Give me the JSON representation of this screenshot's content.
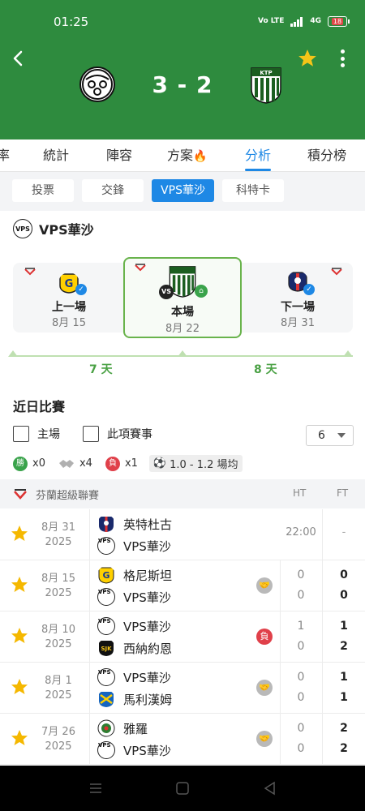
{
  "status": {
    "time": "01:25",
    "network": "4G",
    "volte": "Vo LTE",
    "battery": "18"
  },
  "header": {
    "score": "3 - 2",
    "home_team_icon": "vps-crest-icon",
    "away_team_icon": "ktp-crest-icon",
    "favorite_color": "#f5c518"
  },
  "tabs": [
    {
      "label": "率"
    },
    {
      "label": "統計"
    },
    {
      "label": "陣容"
    },
    {
      "label": "方案"
    },
    {
      "label": "分析",
      "active": true
    },
    {
      "label": "積分榜"
    }
  ],
  "subtabs": [
    {
      "label": "投票"
    },
    {
      "label": "交鋒"
    },
    {
      "label": "VPS華沙",
      "active": true
    },
    {
      "label": "科特卡"
    }
  ],
  "team_section": {
    "title": "VPS華沙"
  },
  "timeline": {
    "prev": {
      "label": "上一場",
      "date": "8月 15"
    },
    "current": {
      "label": "本場",
      "date": "8月 22"
    },
    "next": {
      "label": "下一場",
      "date": "8月 31"
    },
    "gap_before": "7 天",
    "gap_after": "8 天"
  },
  "recent": {
    "title": "近日比賽",
    "filter_home": "主場",
    "filter_competition": "此項賽事",
    "count": "6",
    "wins": "x0",
    "draws": "x4",
    "losses": "x1",
    "win_badge": "勝",
    "loss_badge": "負",
    "avg": "1.0 - 1.2 場均"
  },
  "league": {
    "name": "芬蘭超級聯賽",
    "ht": "HT",
    "ft": "FT"
  },
  "matches": [
    {
      "date": "8月 31",
      "year": "2025",
      "home": "英特杜古",
      "away": "VPS華沙",
      "kickoff": "22:00",
      "ft_placeholder": "-"
    },
    {
      "date": "8月 15",
      "year": "2025",
      "home": "格尼斯坦",
      "away": "VPS華沙",
      "ht_home": "0",
      "ht_away": "0",
      "ft_home": "0",
      "ft_away": "0",
      "result": "draw"
    },
    {
      "date": "8月 10",
      "year": "2025",
      "home": "VPS華沙",
      "away": "西納約恩",
      "ht_home": "1",
      "ht_away": "0",
      "ft_home": "1",
      "ft_away": "2",
      "result": "loss",
      "result_label": "負"
    },
    {
      "date": "8月 1",
      "year": "2025",
      "home": "VPS華沙",
      "away": "馬利漢姆",
      "ht_home": "0",
      "ht_away": "0",
      "ft_home": "1",
      "ft_away": "1",
      "result": "draw"
    },
    {
      "date": "7月 26",
      "year": "2025",
      "home": "雅羅",
      "away": "VPS華沙",
      "ht_home": "0",
      "ht_away": "0",
      "ft_home": "2",
      "ft_away": "2",
      "result": "draw"
    }
  ],
  "colors": {
    "header_green": "#2e8b3e",
    "accent_blue": "#1e88e5",
    "card_green": "#69b34c",
    "win": "#3aa34b",
    "loss": "#e0404a"
  }
}
